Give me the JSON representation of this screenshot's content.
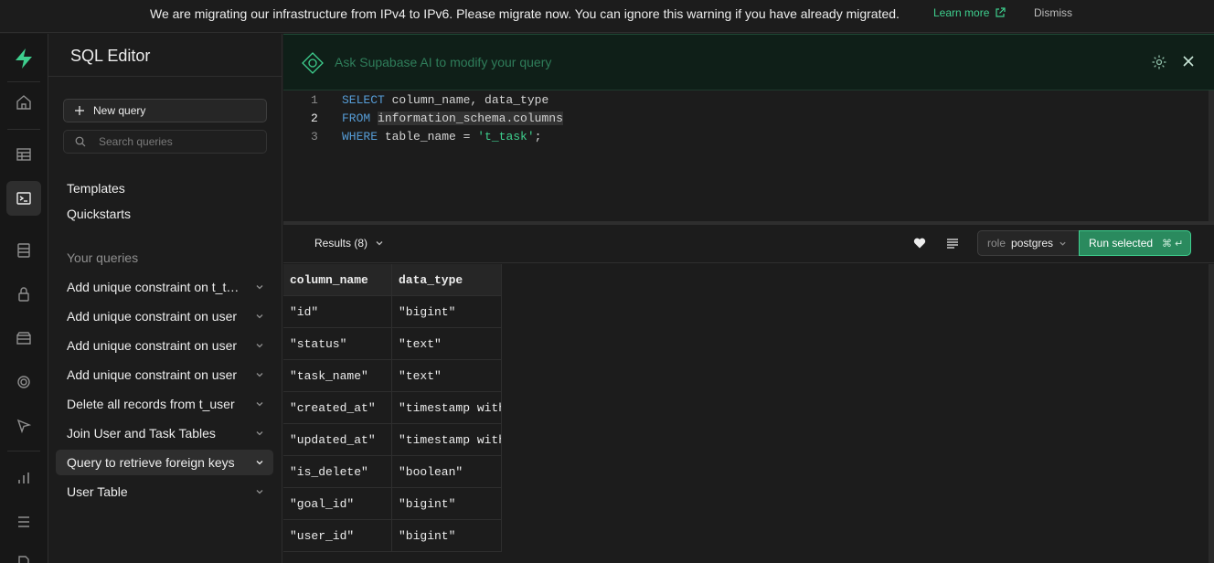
{
  "banner": {
    "message": "We are migrating our infrastructure from IPv4 to IPv6. Please migrate now. You can ignore this warning if you have already migrated.",
    "learn_more": "Learn more",
    "dismiss": "Dismiss"
  },
  "sidebar": {
    "title": "SQL Editor",
    "new_query": "New query",
    "search_placeholder": "Search queries",
    "links": [
      "Templates",
      "Quickstarts"
    ],
    "section_label": "Your queries",
    "queries": [
      "Add unique constraint on t_task",
      "Add unique constraint on user",
      "Add unique constraint on user",
      "Add unique constraint on user",
      "Delete all records from t_user",
      "Join User and Task Tables",
      "Query to retrieve foreign keys",
      "User Table"
    ],
    "active_query_index": 6
  },
  "ai_bar": {
    "placeholder": "Ask Supabase AI to modify your query"
  },
  "editor": {
    "lines": [
      {
        "num": "1",
        "kw": "SELECT",
        "rest": " column_name, data_type"
      },
      {
        "num": "2",
        "kw": "FROM",
        "rest": "information_schema.columns"
      },
      {
        "num": "3",
        "kw": "WHERE",
        "rest": " table_name = ",
        "str": "'t_task'",
        "tail": ";"
      }
    ],
    "current_line": 2
  },
  "toolbar": {
    "results_label": "Results (8)",
    "role_key": "role",
    "role_value": "postgres",
    "run_label": "Run selected",
    "run_shortcut": "⌘ ↵"
  },
  "results": {
    "columns": [
      "column_name",
      "data_type"
    ],
    "rows": [
      [
        "\"id\"",
        "\"bigint\""
      ],
      [
        "\"status\"",
        "\"text\""
      ],
      [
        "\"task_name\"",
        "\"text\""
      ],
      [
        "\"created_at\"",
        "\"timestamp with"
      ],
      [
        "\"updated_at\"",
        "\"timestamp with"
      ],
      [
        "\"is_delete\"",
        "\"boolean\""
      ],
      [
        "\"goal_id\"",
        "\"bigint\""
      ],
      [
        "\"user_id\"",
        "\"bigint\""
      ]
    ]
  },
  "colors": {
    "brand": "#3ecf8e",
    "background": "#1c1c1c",
    "run_button": "#2a8a5e"
  },
  "rail_icons": [
    "supabase-logo-icon",
    "home-icon",
    "table-editor-icon",
    "sql-editor-icon",
    "database-icon",
    "auth-lock-icon",
    "storage-icon",
    "realtime-icon",
    "edge-functions-icon",
    "reports-icon",
    "logs-icon",
    "docs-icon"
  ]
}
